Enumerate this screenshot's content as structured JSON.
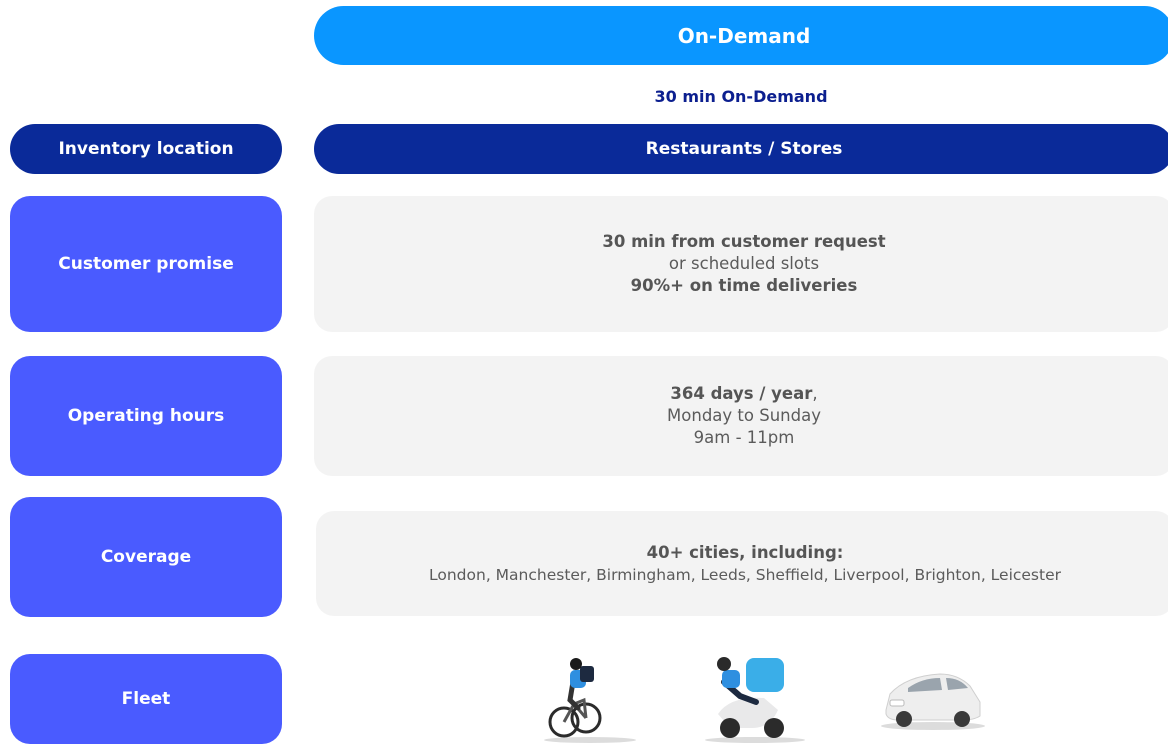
{
  "header": {
    "top_pill": "On-Demand",
    "subtitle": "30 min On-Demand"
  },
  "rows": {
    "inventory": {
      "label": "Inventory location",
      "value": "Restaurants / Stores"
    },
    "promise": {
      "label": "Customer promise",
      "line1": "30 min from customer request",
      "line2": "or scheduled slots",
      "line3": "90%+ on time deliveries"
    },
    "hours": {
      "label": "Operating hours",
      "line1_bold": "364 days / year",
      "line1_rest": ",",
      "line2": "Monday to Sunday",
      "line3": "9am - 11pm"
    },
    "coverage": {
      "label": "Coverage",
      "line1": "40+ cities, including:",
      "line2": "London, Manchester, Birmingham, Leeds, Sheffield, Liverpool, Brighton, Leicester"
    },
    "fleet": {
      "label": "Fleet",
      "icons": [
        "bicycle-rider-icon",
        "scooter-rider-icon",
        "car-icon"
      ]
    }
  },
  "colors": {
    "bright_blue": "#0a96ff",
    "navy": "#0a2a99",
    "indigo": "#4a5bff",
    "box_grey": "#f3f3f3"
  }
}
